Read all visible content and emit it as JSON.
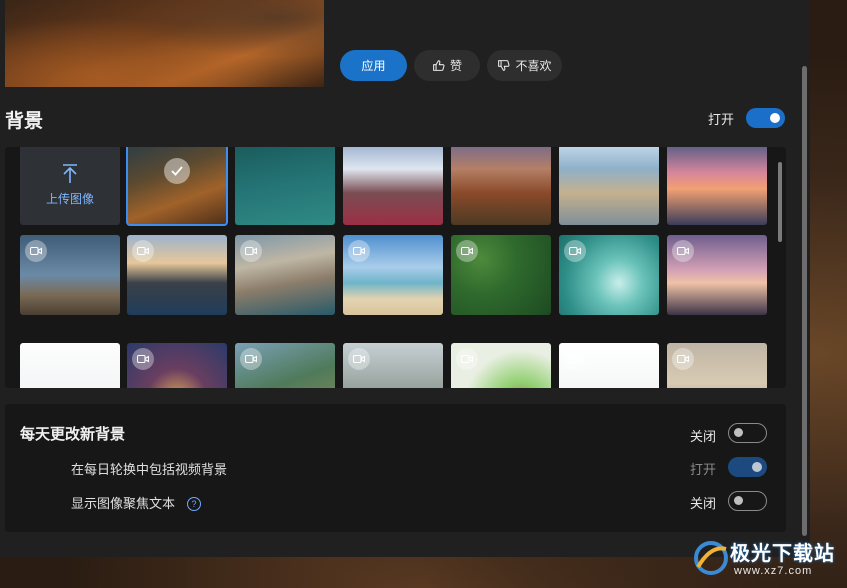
{
  "actions": {
    "apply_label": "应用",
    "like_label": "赞",
    "dislike_label": "不喜欢"
  },
  "background_section": {
    "title": "背景",
    "toggle_label": "打开",
    "toggle_state": "on",
    "upload_label": "上传图像"
  },
  "daily": {
    "title": "每天更改新背景",
    "title_toggle_label": "关闭",
    "include_video_label": "在每日轮换中包括视频背景",
    "include_video_toggle_label": "打开",
    "spotlight_label": "显示图像聚焦文本",
    "spotlight_help": "?",
    "spotlight_toggle_label": "关闭"
  },
  "watermark": {
    "name": "极光下载站",
    "url": "www.xz7.com"
  },
  "colors": {
    "accent": "#1a73c9",
    "panel": "#202020",
    "card": "#171717"
  }
}
